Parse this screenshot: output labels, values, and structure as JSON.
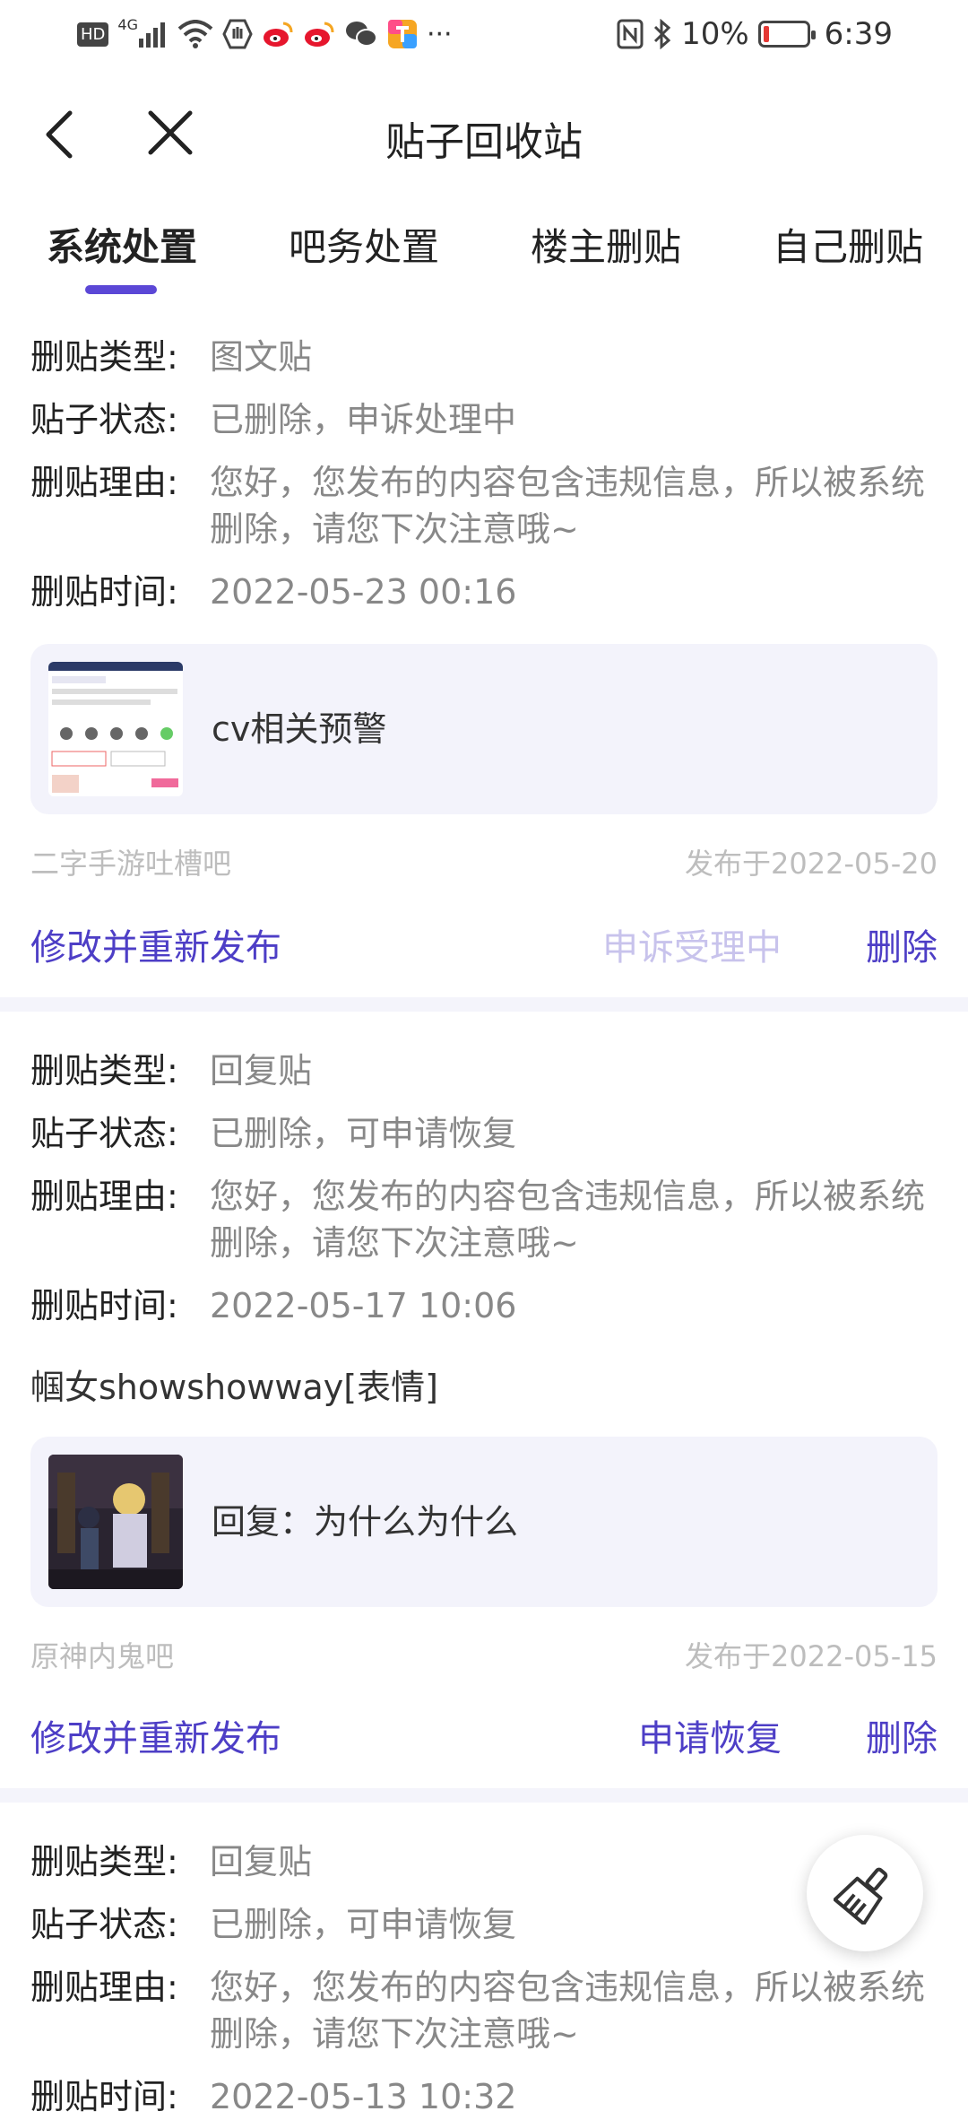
{
  "status_bar": {
    "left_icons": [
      "hd-icon",
      "signal-icon",
      "wifi-icon",
      "app-icon",
      "weibo-icon",
      "weibo-icon",
      "wechat-icon",
      "app-icon",
      "more-icon"
    ],
    "signal_label": "4G",
    "hd_label": "HD",
    "battery_percent": "10%",
    "time": "6:39"
  },
  "navbar": {
    "title": "贴子回收站"
  },
  "tabs": [
    {
      "label": "系统处置",
      "active": true
    },
    {
      "label": "吧务处置",
      "active": false
    },
    {
      "label": "楼主删贴",
      "active": false
    },
    {
      "label": "自己删贴",
      "active": false
    }
  ],
  "labels": {
    "type": "删贴类型:",
    "status": "贴子状态:",
    "reason": "删贴理由:",
    "time": "删贴时间:"
  },
  "posts": [
    {
      "type": "图文贴",
      "status": "已删除，申诉处理中",
      "reason": "您好，您发布的内容包含违规信息，所以被系统删除，请您下次注意哦~",
      "time": "2022-05-23 00:16",
      "card_title": "cv相关预警",
      "forum": "二字手游吐槽吧",
      "published": "发布于2022-05-20",
      "action_edit": "修改并重新发布",
      "action_status": "申诉受理中",
      "action_delete": "删除"
    },
    {
      "type": "回复贴",
      "status": "已删除，可申请恢复",
      "reason": "您好，您发布的内容包含违规信息，所以被系统删除，请您下次注意哦~",
      "time": "2022-05-17 10:06",
      "content": "帼女showshowway[表情]",
      "card_title": "回复：为什么为什么",
      "forum": "原神内鬼吧",
      "published": "发布于2022-05-15",
      "action_edit": "修改并重新发布",
      "action_status": "申请恢复",
      "action_delete": "删除"
    },
    {
      "type": "回复贴",
      "status": "已删除，可申请恢复",
      "reason": "您好，您发布的内容包含违规信息，所以被系统删除，请您下次注意哦~",
      "time": "2022-05-13 10:32"
    }
  ],
  "colors": {
    "accent": "#4d3ec6",
    "indicator": "#5b47d6",
    "card_bg": "#f3f3fb",
    "muted": "#888888"
  }
}
